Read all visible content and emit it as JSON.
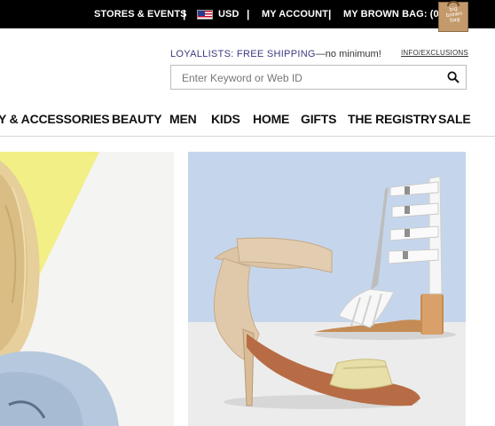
{
  "topbar": {
    "stores_events": "STORES & EVENTS",
    "currency": "USD",
    "my_account": "MY ACCOUNT",
    "my_brown_bag": "MY BROWN BAG: (0)",
    "separator": "|",
    "bag_logo": "big brown bag"
  },
  "promo": {
    "strong": "LOYALLISTS: FREE SHIPPING",
    "light": "—no minimum!",
    "info_link": "INFO/EXCLUSIONS"
  },
  "search": {
    "placeholder": "Enter Keyword or Web ID"
  },
  "nav": {
    "items": [
      "Y & ACCESSORIES",
      "BEAUTY",
      "MEN",
      "KIDS",
      "HOME",
      "GIFTS",
      "THE REGISTRY",
      "SALE"
    ]
  },
  "colors": {
    "topbar_bg": "#000000",
    "promo_accent": "#3a3a82",
    "sky_blue": "#c5d6ec",
    "yellow_burst": "#f2ef86"
  }
}
